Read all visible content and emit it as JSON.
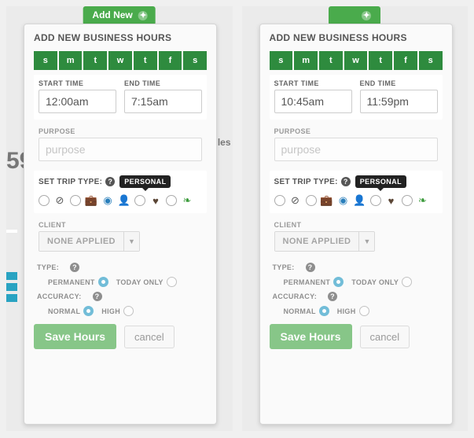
{
  "shared": {
    "add_new_btn": "Add New",
    "panel_title": "ADD NEW BUSINESS HOURS",
    "days": [
      "s",
      "m",
      "t",
      "w",
      "t",
      "f",
      "s"
    ],
    "start_label": "START TIME",
    "end_label": "END TIME",
    "purpose_label": "PURPOSE",
    "purpose_placeholder": "purpose",
    "trip_label": "SET TRIP TYPE:",
    "tooltip": "PERSONAL",
    "client_label": "CLIENT",
    "client_value": "NONE APPLIED",
    "type_label": "TYPE:",
    "permanent_label": "PERMANENT",
    "today_label": "TODAY ONLY",
    "accuracy_label": "ACCURACY:",
    "normal_label": "NORMAL",
    "high_label": "HIGH",
    "save_label": "Save Hours",
    "cancel_label": "cancel",
    "trip_types": [
      "unclassified",
      "no-entry",
      "unclassified",
      "business",
      "personal",
      "user",
      "unclassified",
      "heart",
      "unclassified",
      "leaf"
    ]
  },
  "left": {
    "start_time": "12:00am",
    "end_time": "7:15am",
    "type_selected": "permanent",
    "accuracy_selected": "normal",
    "bg_number": "59",
    "bg_unit": "les"
  },
  "right": {
    "start_time": "10:45am",
    "end_time": "11:59pm",
    "type_selected": "permanent",
    "accuracy_selected": "normal"
  }
}
